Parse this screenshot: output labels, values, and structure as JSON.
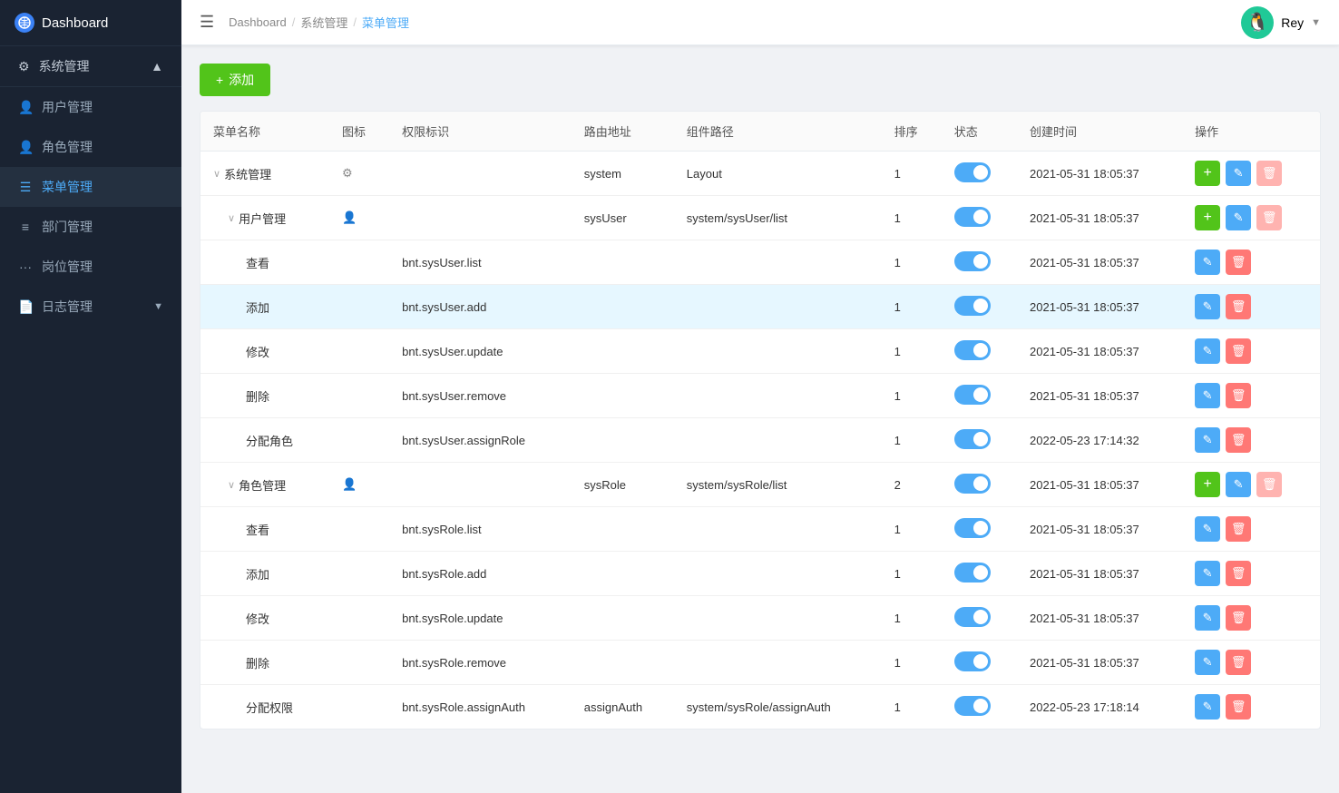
{
  "app": {
    "title": "Dashboard",
    "logo_icon": "🌐"
  },
  "topbar": {
    "breadcrumbs": [
      "Dashboard",
      "系统管理",
      "菜单管理"
    ],
    "user_emoji": "🐧",
    "user_name": "Rey"
  },
  "sidebar": {
    "section_label": "系统管理",
    "items": [
      {
        "id": "user-mgmt",
        "label": "用户管理",
        "icon": "👤"
      },
      {
        "id": "role-mgmt",
        "label": "角色管理",
        "icon": "👤"
      },
      {
        "id": "menu-mgmt",
        "label": "菜单管理",
        "icon": "☰",
        "active": true
      },
      {
        "id": "dept-mgmt",
        "label": "部门管理",
        "icon": "≡"
      },
      {
        "id": "post-mgmt",
        "label": "岗位管理",
        "icon": "···"
      },
      {
        "id": "log-mgmt",
        "label": "日志管理",
        "icon": "📄"
      }
    ]
  },
  "toolbar": {
    "add_label": "+ 添加"
  },
  "table": {
    "columns": [
      "菜单名称",
      "图标",
      "权限标识",
      "路由地址",
      "组件路径",
      "排序",
      "状态",
      "创建时间",
      "操作"
    ],
    "rows": [
      {
        "id": 1,
        "name": "系统管理",
        "indent": 0,
        "collapsed": true,
        "icon": "⚙",
        "permission": "",
        "route": "system",
        "component": "Layout",
        "sort": 1,
        "status": true,
        "created": "2021-05-31 18:05:37",
        "has_add": true,
        "del_light": true
      },
      {
        "id": 2,
        "name": "用户管理",
        "indent": 1,
        "collapsed": true,
        "icon": "👤",
        "permission": "",
        "route": "sysUser",
        "component": "system/sysUser/list",
        "sort": 1,
        "status": true,
        "created": "2021-05-31 18:05:37",
        "has_add": true,
        "del_light": true
      },
      {
        "id": 3,
        "name": "查看",
        "indent": 2,
        "icon": "",
        "permission": "bnt.sysUser.list",
        "route": "",
        "component": "",
        "sort": 1,
        "status": true,
        "created": "2021-05-31 18:05:37",
        "has_add": false,
        "del_light": false
      },
      {
        "id": 4,
        "name": "添加",
        "indent": 2,
        "icon": "",
        "permission": "bnt.sysUser.add",
        "route": "",
        "component": "",
        "sort": 1,
        "status": true,
        "created": "2021-05-31 18:05:37",
        "has_add": false,
        "del_light": false,
        "highlighted": true
      },
      {
        "id": 5,
        "name": "修改",
        "indent": 2,
        "icon": "",
        "permission": "bnt.sysUser.update",
        "route": "",
        "component": "",
        "sort": 1,
        "status": true,
        "created": "2021-05-31 18:05:37",
        "has_add": false,
        "del_light": false
      },
      {
        "id": 6,
        "name": "删除",
        "indent": 2,
        "icon": "",
        "permission": "bnt.sysUser.remove",
        "route": "",
        "component": "",
        "sort": 1,
        "status": true,
        "created": "2021-05-31 18:05:37",
        "has_add": false,
        "del_light": false
      },
      {
        "id": 7,
        "name": "分配角色",
        "indent": 2,
        "icon": "",
        "permission": "bnt.sysUser.assignRole",
        "route": "",
        "component": "",
        "sort": 1,
        "status": true,
        "created": "2022-05-23 17:14:32",
        "has_add": false,
        "del_light": false
      },
      {
        "id": 8,
        "name": "角色管理",
        "indent": 1,
        "collapsed": true,
        "icon": "👤",
        "permission": "",
        "route": "sysRole",
        "component": "system/sysRole/list",
        "sort": 2,
        "status": true,
        "created": "2021-05-31 18:05:37",
        "has_add": true,
        "del_light": true
      },
      {
        "id": 9,
        "name": "查看",
        "indent": 2,
        "icon": "",
        "permission": "bnt.sysRole.list",
        "route": "",
        "component": "",
        "sort": 1,
        "status": true,
        "created": "2021-05-31 18:05:37",
        "has_add": false,
        "del_light": false
      },
      {
        "id": 10,
        "name": "添加",
        "indent": 2,
        "icon": "",
        "permission": "bnt.sysRole.add",
        "route": "",
        "component": "",
        "sort": 1,
        "status": true,
        "created": "2021-05-31 18:05:37",
        "has_add": false,
        "del_light": false
      },
      {
        "id": 11,
        "name": "修改",
        "indent": 2,
        "icon": "",
        "permission": "bnt.sysRole.update",
        "route": "",
        "component": "",
        "sort": 1,
        "status": true,
        "created": "2021-05-31 18:05:37",
        "has_add": false,
        "del_light": false
      },
      {
        "id": 12,
        "name": "删除",
        "indent": 2,
        "icon": "",
        "permission": "bnt.sysRole.remove",
        "route": "",
        "component": "",
        "sort": 1,
        "status": true,
        "created": "2021-05-31 18:05:37",
        "has_add": false,
        "del_light": false
      },
      {
        "id": 13,
        "name": "分配权限",
        "indent": 2,
        "icon": "",
        "permission": "bnt.sysRole.assignAuth",
        "route": "assignAuth",
        "component": "system/sysRole/assignAuth",
        "sort": 1,
        "status": true,
        "created": "2022-05-23 17:18:14",
        "has_add": false,
        "del_light": false
      }
    ]
  }
}
